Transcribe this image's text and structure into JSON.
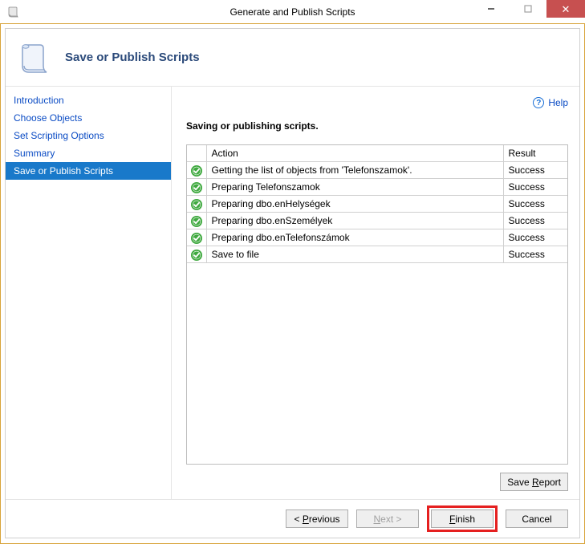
{
  "window": {
    "title": "Generate and Publish Scripts"
  },
  "header": {
    "title": "Save or Publish Scripts"
  },
  "sidebar": {
    "items": [
      {
        "label": "Introduction",
        "active": false
      },
      {
        "label": "Choose Objects",
        "active": false
      },
      {
        "label": "Set Scripting Options",
        "active": false
      },
      {
        "label": "Summary",
        "active": false
      },
      {
        "label": "Save or Publish Scripts",
        "active": true
      }
    ]
  },
  "help": {
    "label": "Help"
  },
  "main": {
    "section_title": "Saving or publishing scripts.",
    "columns": {
      "icon": "",
      "action": "Action",
      "result": "Result"
    },
    "rows": [
      {
        "action": "Getting the list of objects from 'Telefonszamok'.",
        "result": "Success"
      },
      {
        "action": "Preparing Telefonszamok",
        "result": "Success"
      },
      {
        "action": "Preparing dbo.enHelységek",
        "result": "Success"
      },
      {
        "action": "Preparing dbo.enSzemélyek",
        "result": "Success"
      },
      {
        "action": "Preparing dbo.enTelefonszámok",
        "result": "Success"
      },
      {
        "action": "Save to file",
        "result": "Success"
      }
    ],
    "save_report_label": "Save Report"
  },
  "footer": {
    "previous_label": "Previous",
    "next_label": "Next",
    "finish_label": "Finish",
    "cancel_label": "Cancel"
  }
}
